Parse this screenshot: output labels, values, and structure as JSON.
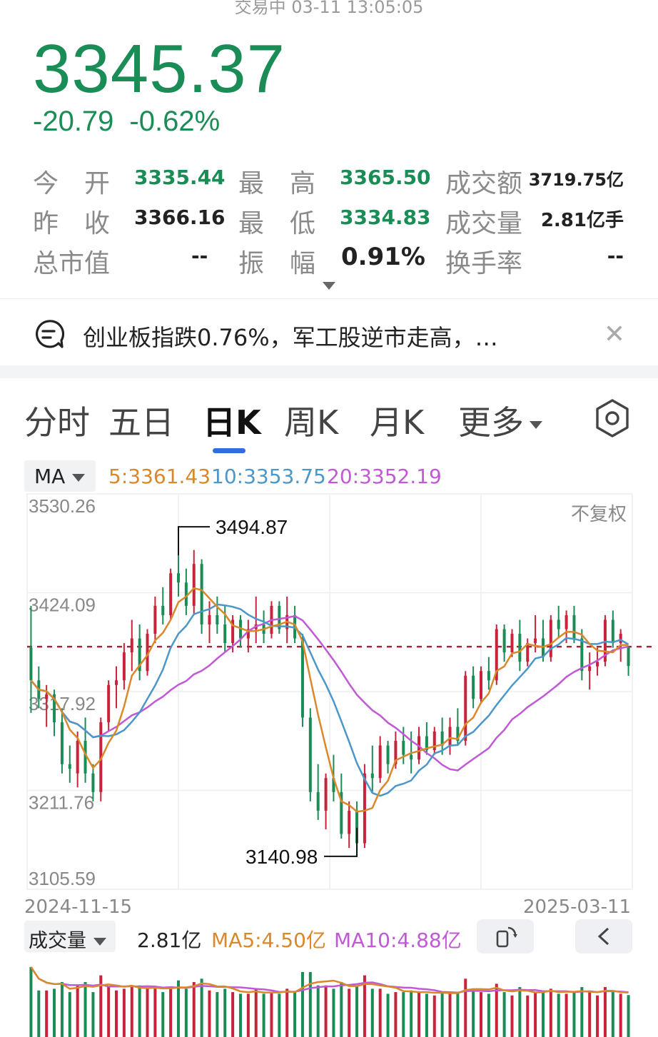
{
  "header": {
    "status": "交易中 03-11 13:05:05",
    "price": "3345.37",
    "change": "-20.79",
    "change_pct": "-0.62%"
  },
  "stats": {
    "open_label": "今　开",
    "open_value": "3335.44",
    "high_label": "最　高",
    "high_value": "3365.50",
    "amount_label": "成交额",
    "amount_value": "3719.75亿",
    "prev_close_label": "昨　收",
    "prev_close_value": "3366.16",
    "low_label": "最　低",
    "low_value": "3334.83",
    "volume_label": "成交量",
    "volume_value": "2.81亿手",
    "mktcap_label": "总市值",
    "mktcap_value": "--",
    "amplitude_label": "振　幅",
    "amplitude_value": "0.91%",
    "turnover_label": "换手率",
    "turnover_value": "--"
  },
  "news": {
    "text": "创业板指跌0.76%，军工股逆市走高，…",
    "close_glyph": "✕"
  },
  "tabs": [
    "分时",
    "五日",
    "日K",
    "周K",
    "月K",
    "更多"
  ],
  "ma": {
    "selector": "MA",
    "ma5": "5:3361.43",
    "ma10": "10:3353.75",
    "ma20": "20:3352.19"
  },
  "chart": {
    "y_labels": [
      "3530.26",
      "3424.09",
      "3317.92",
      "3211.76",
      "3105.59"
    ],
    "adjust_label": "不复权",
    "start_date": "2024-11-15",
    "end_date": "2025-03-11",
    "max_label": "3494.87",
    "min_label": "3140.98",
    "ref_line": 3366.16
  },
  "volume": {
    "selector": "成交量",
    "value": "2.81亿",
    "ma5": "MA5:4.50亿",
    "ma10": "MA10:4.88亿"
  },
  "colors": {
    "up": "#c8233a",
    "down": "#1a8c55",
    "ma5": "#d9882a",
    "ma10": "#4c97c9",
    "ma20": "#c159d6",
    "accent": "#2f6de1"
  },
  "chart_data": {
    "type": "candlestick",
    "y_range": [
      3105.59,
      3530.26
    ],
    "candles": [
      [
        3365,
        3410,
        3295,
        3330
      ],
      [
        3330,
        3345,
        3300,
        3310
      ],
      [
        3310,
        3325,
        3280,
        3315
      ],
      [
        3315,
        3320,
        3270,
        3285
      ],
      [
        3285,
        3300,
        3230,
        3240
      ],
      [
        3240,
        3260,
        3220,
        3235
      ],
      [
        3230,
        3275,
        3215,
        3265
      ],
      [
        3265,
        3290,
        3220,
        3230
      ],
      [
        3230,
        3240,
        3200,
        3210
      ],
      [
        3210,
        3290,
        3200,
        3285
      ],
      [
        3285,
        3330,
        3275,
        3325
      ],
      [
        3325,
        3345,
        3300,
        3330
      ],
      [
        3330,
        3370,
        3320,
        3360
      ],
      [
        3360,
        3395,
        3340,
        3375
      ],
      [
        3375,
        3390,
        3330,
        3340
      ],
      [
        3340,
        3385,
        3335,
        3380
      ],
      [
        3380,
        3420,
        3370,
        3410
      ],
      [
        3410,
        3430,
        3390,
        3400
      ],
      [
        3400,
        3450,
        3395,
        3445
      ],
      [
        3445,
        3494.87,
        3420,
        3435
      ],
      [
        3435,
        3450,
        3400,
        3410
      ],
      [
        3410,
        3470,
        3400,
        3455
      ],
      [
        3455,
        3460,
        3380,
        3390
      ],
      [
        3390,
        3415,
        3370,
        3400
      ],
      [
        3400,
        3420,
        3380,
        3390
      ],
      [
        3390,
        3410,
        3360,
        3370
      ],
      [
        3370,
        3400,
        3360,
        3395
      ],
      [
        3395,
        3400,
        3365,
        3375
      ],
      [
        3375,
        3395,
        3360,
        3385
      ],
      [
        3385,
        3420,
        3370,
        3390
      ],
      [
        3390,
        3405,
        3370,
        3380
      ],
      [
        3380,
        3415,
        3375,
        3410
      ],
      [
        3410,
        3415,
        3380,
        3385
      ],
      [
        3385,
        3420,
        3370,
        3400
      ],
      [
        3400,
        3410,
        3370,
        3375
      ],
      [
        3375,
        3380,
        3280,
        3290
      ],
      [
        3290,
        3300,
        3200,
        3210
      ],
      [
        3210,
        3240,
        3180,
        3190
      ],
      [
        3190,
        3230,
        3170,
        3225
      ],
      [
        3225,
        3250,
        3200,
        3210
      ],
      [
        3210,
        3230,
        3160,
        3165
      ],
      [
        3165,
        3200,
        3150,
        3190
      ],
      [
        3190,
        3200,
        3140.98,
        3155
      ],
      [
        3155,
        3240,
        3150,
        3230
      ],
      [
        3230,
        3260,
        3210,
        3225
      ],
      [
        3225,
        3270,
        3220,
        3260
      ],
      [
        3260,
        3265,
        3230,
        3240
      ],
      [
        3240,
        3275,
        3235,
        3265
      ],
      [
        3265,
        3280,
        3240,
        3250
      ],
      [
        3250,
        3275,
        3230,
        3245
      ],
      [
        3245,
        3280,
        3240,
        3270
      ],
      [
        3270,
        3285,
        3250,
        3255
      ],
      [
        3255,
        3280,
        3250,
        3275
      ],
      [
        3275,
        3290,
        3250,
        3260
      ],
      [
        3260,
        3290,
        3250,
        3280
      ],
      [
        3280,
        3300,
        3260,
        3265
      ],
      [
        3265,
        3340,
        3260,
        3335
      ],
      [
        3335,
        3345,
        3300,
        3310
      ],
      [
        3310,
        3345,
        3305,
        3340
      ],
      [
        3340,
        3355,
        3320,
        3330
      ],
      [
        3330,
        3390,
        3325,
        3385
      ],
      [
        3385,
        3390,
        3350,
        3360
      ],
      [
        3360,
        3385,
        3355,
        3380
      ],
      [
        3380,
        3395,
        3340,
        3350
      ],
      [
        3350,
        3375,
        3345,
        3370
      ],
      [
        3370,
        3400,
        3360,
        3375
      ],
      [
        3375,
        3395,
        3350,
        3355
      ],
      [
        3355,
        3400,
        3350,
        3395
      ],
      [
        3395,
        3410,
        3375,
        3385
      ],
      [
        3385,
        3405,
        3370,
        3400
      ],
      [
        3400,
        3410,
        3370,
        3375
      ],
      [
        3375,
        3385,
        3330,
        3340
      ],
      [
        3340,
        3360,
        3320,
        3345
      ],
      [
        3345,
        3365,
        3335,
        3350
      ],
      [
        3350,
        3400,
        3345,
        3395
      ],
      [
        3395,
        3405,
        3365,
        3370
      ],
      [
        3370,
        3385,
        3350,
        3380
      ],
      [
        3366,
        3366,
        3334.83,
        3345.37
      ]
    ]
  }
}
